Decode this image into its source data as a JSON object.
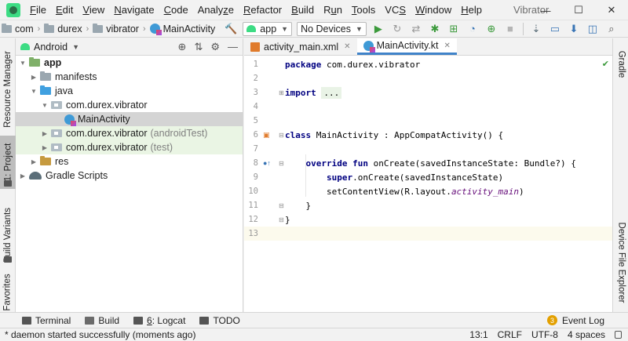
{
  "menubar": {
    "items": [
      {
        "pre": "",
        "u": "F",
        "post": "ile"
      },
      {
        "pre": "",
        "u": "E",
        "post": "dit"
      },
      {
        "pre": "",
        "u": "V",
        "post": "iew"
      },
      {
        "pre": "",
        "u": "N",
        "post": "avigate"
      },
      {
        "pre": "",
        "u": "C",
        "post": "ode"
      },
      {
        "pre": "Analy",
        "u": "z",
        "post": "e"
      },
      {
        "pre": "",
        "u": "R",
        "post": "efactor"
      },
      {
        "pre": "",
        "u": "B",
        "post": "uild"
      },
      {
        "pre": "R",
        "u": "u",
        "post": "n"
      },
      {
        "pre": "",
        "u": "T",
        "post": "ools"
      },
      {
        "pre": "VC",
        "u": "S",
        "post": ""
      },
      {
        "pre": "",
        "u": "W",
        "post": "indow"
      },
      {
        "pre": "",
        "u": "H",
        "post": "elp"
      }
    ],
    "window_title": "Vibrator",
    "minimize": "—",
    "maximize": "☐",
    "close": "✕"
  },
  "toolbar": {
    "breadcrumbs": [
      "com",
      "durex",
      "vibrator",
      "MainActivity"
    ],
    "run_config": "app",
    "device": "No Devices"
  },
  "left_stripe": {
    "resource_manager": "Resource Manager",
    "project": "1: Project",
    "build_variants": "Build Variants",
    "favorites": "Favorites"
  },
  "right_stripe": {
    "gradle": "Gradle",
    "device_file_explorer": "Device File Explorer"
  },
  "project_panel": {
    "view": "Android",
    "tree": {
      "app": "app",
      "manifests": "manifests",
      "java": "java",
      "pkg_main": "com.durex.vibrator",
      "main_activity": "MainActivity",
      "pkg_android_test": "com.durex.vibrator",
      "android_test_suffix": "(androidTest)",
      "pkg_test": "com.durex.vibrator",
      "test_suffix": "(test)",
      "res": "res",
      "gradle_scripts": "Gradle Scripts"
    }
  },
  "editor": {
    "tabs": [
      "activity_main.xml",
      "MainActivity.kt"
    ],
    "active_tab": 1,
    "line_numbers": [
      "1",
      "2",
      "3",
      "4",
      "5",
      "6",
      "7",
      "8",
      "9",
      "10",
      "11",
      "12",
      "13"
    ],
    "code": {
      "l1_kw": "package",
      "l1_rest": " com.durex.vibrator",
      "l3_kw": "import",
      "l3_fold": "...",
      "l6_kw": "class",
      "l6_rest": " MainActivity : AppCompatActivity() {",
      "l8_kw1": "override",
      "l8_kw2": "fun",
      "l8_rest": " onCreate(savedInstanceState: Bundle?) {",
      "l9_kw": "super",
      "l9_rest": ".onCreate(savedInstanceState)",
      "l10_pre": "setContentView(R.layout.",
      "l10_it": "activity_main",
      "l10_post": ")",
      "l11": "}",
      "l12": "}"
    }
  },
  "bottom_bar": {
    "terminal": "Terminal",
    "build": "Build",
    "logcat_num": "6",
    "logcat": ": Logcat",
    "todo": "TODO",
    "event_log_count": "3",
    "event_log": "Event Log"
  },
  "status_bar": {
    "message": "* daemon started successfully (moments ago)",
    "position": "13:1",
    "line_sep": "CRLF",
    "encoding": "UTF-8",
    "indent": "4 spaces"
  }
}
